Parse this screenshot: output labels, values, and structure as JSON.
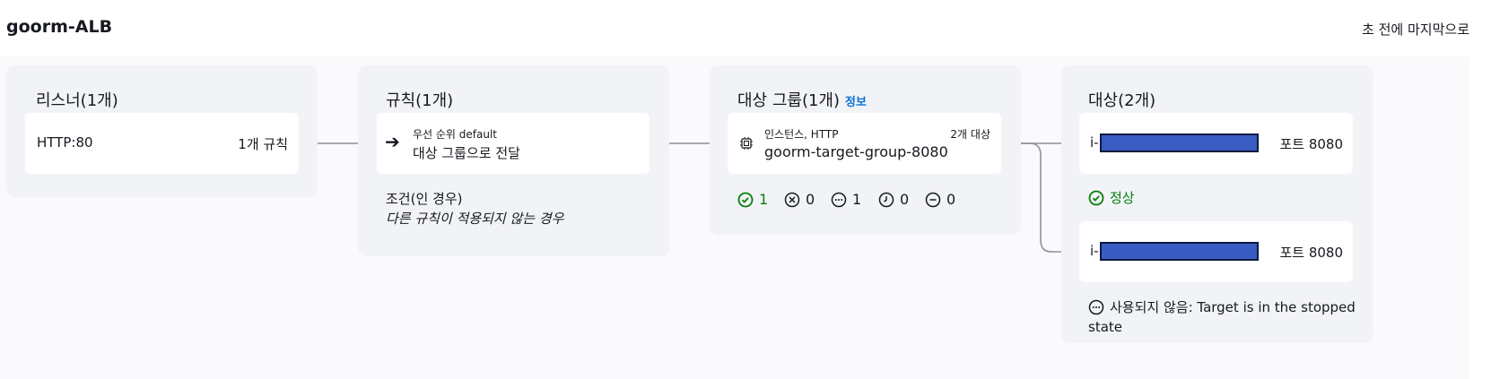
{
  "header": {
    "title": "goorm-ALB",
    "last_updated": "초 전에 마지막으로"
  },
  "listeners": {
    "title": "리스너(1개)",
    "item": {
      "protocol": "HTTP:80",
      "rules": "1개 규칙"
    }
  },
  "rules": {
    "title": "규칙(1개)",
    "item": {
      "priority": "우선 순위 default",
      "action": "대상 그룹으로 전달"
    },
    "condition_label": "조건(인 경우)",
    "condition_value": "다른 규칙이 적용되지 않는 경우"
  },
  "target_groups": {
    "title": "대상 그룹(1개)",
    "info_label": "정보",
    "item": {
      "type": "인스턴스, HTTP",
      "name": "goorm-target-group-8080",
      "targets": "2개 대상",
      "icon": "chip-icon"
    },
    "stats": [
      {
        "icon": "check-circle-icon",
        "value": "1",
        "color": "#037f0c"
      },
      {
        "icon": "x-circle-icon",
        "value": "0",
        "color": "#16191f"
      },
      {
        "icon": "ellipsis-circle-icon",
        "value": "1",
        "color": "#16191f"
      },
      {
        "icon": "clock-circle-icon",
        "value": "0",
        "color": "#16191f"
      },
      {
        "icon": "minus-circle-icon",
        "value": "0",
        "color": "#16191f"
      }
    ]
  },
  "targets": {
    "title": "대상(2개)",
    "items": [
      {
        "id_prefix": "i-",
        "port": "포트 8080",
        "status_icon": "check-circle-icon",
        "status": "정상"
      },
      {
        "id_prefix": "i-",
        "port": "포트 8080",
        "status_icon": "ellipsis-circle-icon",
        "status": "사용되지 않음: Target is in the stopped",
        "status_line2": "state"
      }
    ]
  },
  "colors": {
    "healthy": "#037f0c",
    "link": "#0972d3",
    "redaction": "#3a5cc2"
  }
}
